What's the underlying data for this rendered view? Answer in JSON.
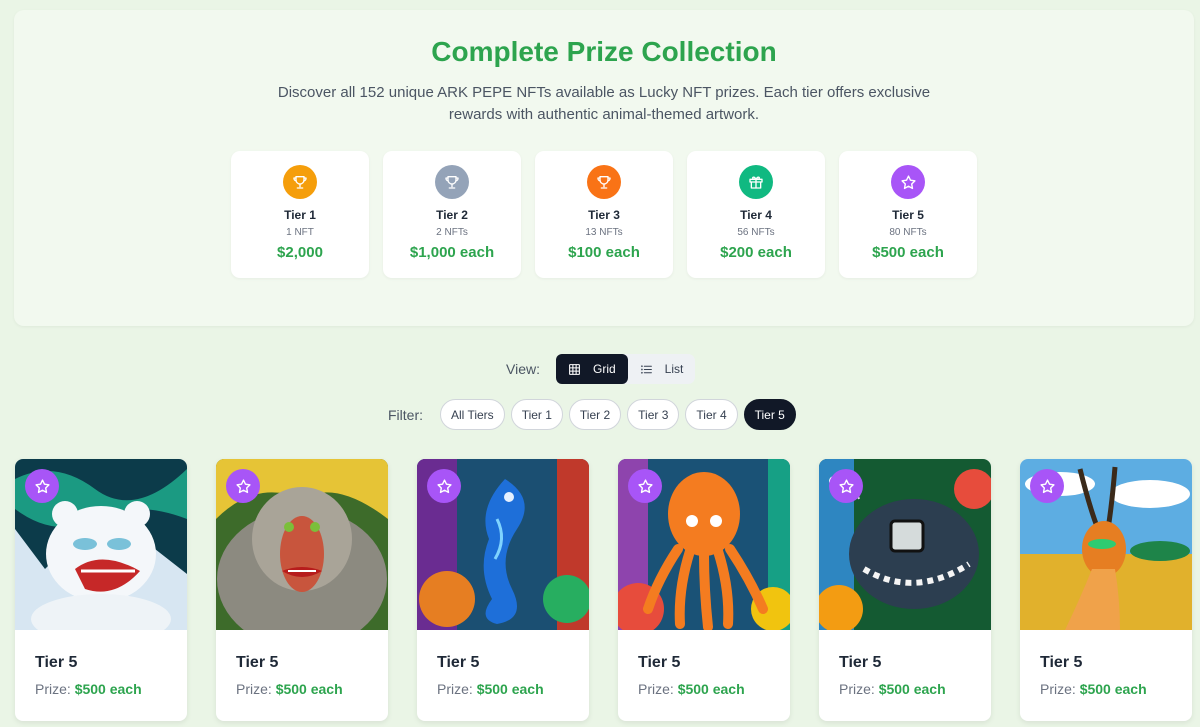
{
  "hero": {
    "title": "Complete Prize Collection",
    "description": "Discover all 152 unique ARK PEPE NFTs available as Lucky NFT prizes. Each tier offers exclusive rewards with authentic animal-themed artwork."
  },
  "tiers": [
    {
      "name": "Tier 1",
      "count": "1 NFT",
      "price": "$2,000",
      "icon": "trophy-icon",
      "color": "#f59e0b"
    },
    {
      "name": "Tier 2",
      "count": "2 NFTs",
      "price": "$1,000 each",
      "icon": "trophy-icon",
      "color": "#94a3b8"
    },
    {
      "name": "Tier 3",
      "count": "13 NFTs",
      "price": "$100 each",
      "icon": "trophy-icon",
      "color": "#f97316"
    },
    {
      "name": "Tier 4",
      "count": "56 NFTs",
      "price": "$200 each",
      "icon": "gift-icon",
      "color": "#10b981"
    },
    {
      "name": "Tier 5",
      "count": "80 NFTs",
      "price": "$500 each",
      "icon": "star-icon",
      "color": "#a855f7"
    }
  ],
  "view": {
    "label": "View:",
    "options": [
      {
        "label": "Grid",
        "icon": "grid-icon",
        "active": true
      },
      {
        "label": "List",
        "icon": "list-icon",
        "active": false
      }
    ]
  },
  "filter": {
    "label": "Filter:",
    "options": [
      "All Tiers",
      "Tier 1",
      "Tier 2",
      "Tier 3",
      "Tier 4",
      "Tier 5"
    ],
    "selected": "Tier 5"
  },
  "cards": [
    {
      "tier": "Tier 5",
      "prize_label": "Prize:",
      "prize": "$500 each",
      "art": "polar-bear"
    },
    {
      "tier": "Tier 5",
      "prize_label": "Prize:",
      "prize": "$500 each",
      "art": "baboon"
    },
    {
      "tier": "Tier 5",
      "prize_label": "Prize:",
      "prize": "$500 each",
      "art": "seahorse"
    },
    {
      "tier": "Tier 5",
      "prize_label": "Prize:",
      "prize": "$500 each",
      "art": "octopus"
    },
    {
      "tier": "Tier 5",
      "prize_label": "Prize:",
      "prize": "$500 each",
      "art": "anglerfish"
    },
    {
      "tier": "Tier 5",
      "prize_label": "Prize:",
      "prize": "$500 each",
      "art": "gazelle"
    }
  ],
  "colors": {
    "accent_green": "#2da44e",
    "dark": "#111827",
    "tier5_purple": "#a855f7"
  }
}
